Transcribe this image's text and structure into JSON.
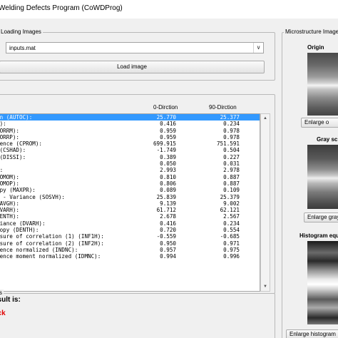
{
  "window": {
    "title": "Welding Defects Program (CoWDProg)"
  },
  "loading": {
    "label": "Loading Images",
    "selected_file": "inputs.mat",
    "load_button": "Load image"
  },
  "features": {
    "col_0": "0-Dirction",
    "col_90": "90-Dirction",
    "rows": [
      {
        "name": "on (AUTOC):",
        "v0": "25.770",
        "v90": "25.377"
      },
      {
        "name": "R):",
        "v0": "0.416",
        "v90": "0.234"
      },
      {
        "name": "CORRM):",
        "v0": "0.959",
        "v90": "0.978"
      },
      {
        "name": "CORRP):",
        "v0": "0.959",
        "v90": "0.978"
      },
      {
        "name": "nence (CPROM):",
        "v0": "699.915",
        "v90": "751.591"
      },
      {
        "name": " (CSHAD):",
        "v0": "-1.749",
        "v90": "0.504"
      },
      {
        "name": " (DISSI):",
        "v0": "0.389",
        "v90": "0.227"
      },
      {
        "name": ":",
        "v0": "0.050",
        "v90": "0.031"
      },
      {
        "name": "):",
        "v0": "2.993",
        "v90": "2.978"
      },
      {
        "name": "HOMOM):",
        "v0": "0.810",
        "v90": "0.887"
      },
      {
        "name": "HOMOP):",
        "v0": "0.806",
        "v90": "0.887"
      },
      {
        "name": "opy (MAXPR):",
        "v0": "0.089",
        "v90": "0.109"
      },
      {
        "name": "s - Variance (SOSVH):",
        "v0": "25.839",
        "v90": "25.379"
      },
      {
        "name": "SAVGH):",
        "v0": "9.139",
        "v90": "9.002"
      },
      {
        "name": "SVARH):",
        "v0": "61.712",
        "v90": "62.121"
      },
      {
        "name": "SENTH):",
        "v0": "2.678",
        "v90": "2.567"
      },
      {
        "name": "riance (DVARH):",
        "v0": "0.416",
        "v90": "0.234"
      },
      {
        "name": "ropy (DENTH):",
        "v0": "0.720",
        "v90": "0.554"
      },
      {
        "name": "asure of correlation (1) (INF1H):",
        "v0": "-0.559",
        "v90": "-0.685"
      },
      {
        "name": "asure of correlation (2) (INF2H):",
        "v0": "0.950",
        "v90": "0.971"
      },
      {
        "name": "rence normalized (INDNC):",
        "v0": "0.957",
        "v90": "0.975"
      },
      {
        "name": "rence moment normalized (IDMNC):",
        "v0": "0.994",
        "v90": "0.996"
      }
    ]
  },
  "result": {
    "panel_label": "s",
    "label": "esult is:",
    "value": "ack"
  },
  "microstructure": {
    "label": "Microstructure Images",
    "original_title": "Origin",
    "enlarge_original": "Enlarge o",
    "gray_title": "Gray sc",
    "enlarge_gray": "Enlarge gray",
    "histogram_title": "Histogram equ",
    "enlarge_histogram": "Enlarge histogram"
  },
  "colors": {
    "selection": "#3399ff",
    "result_text": "#e00000"
  }
}
